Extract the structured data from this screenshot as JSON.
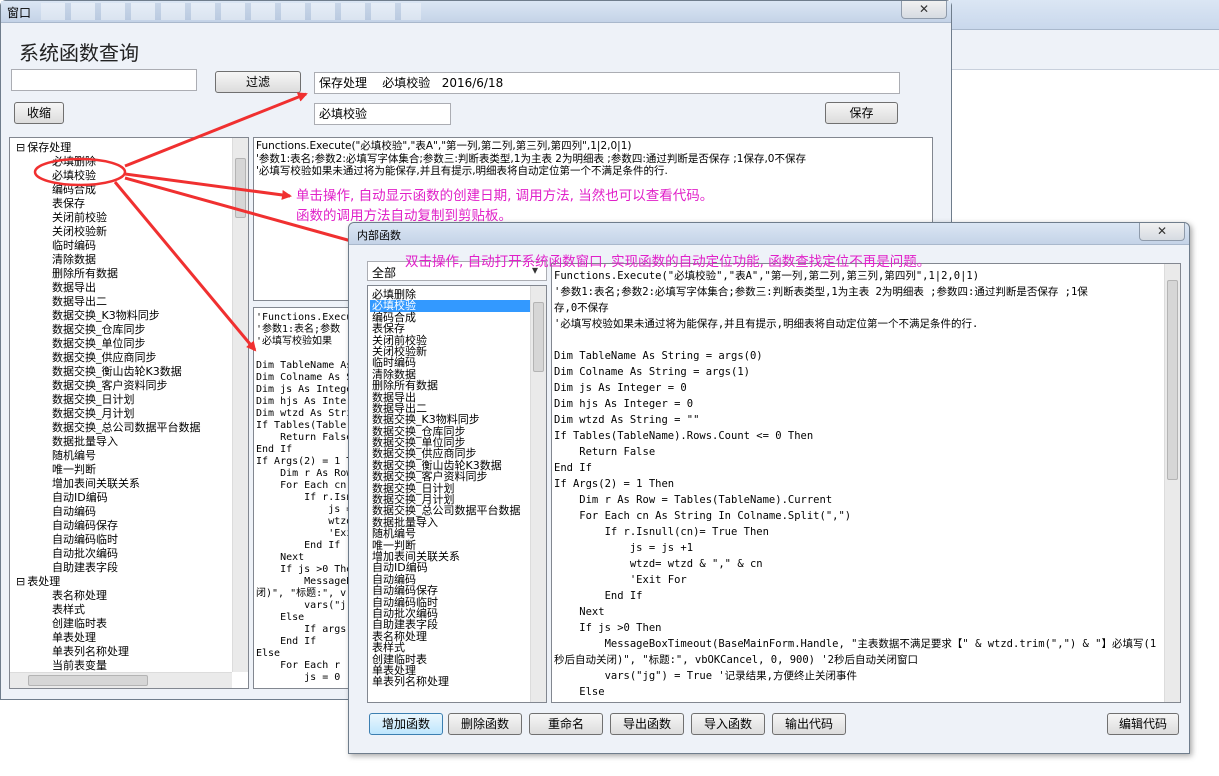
{
  "main_window": {
    "title": "窗口",
    "heading": "系统函数查询",
    "filter_button": "过滤",
    "collapse_button": "收缩",
    "save_button": "保存",
    "filter_input_value": "",
    "info_line": "保存处理    必填校验   2016/6/18",
    "name_value": "必填校验",
    "close_glyph": "✕"
  },
  "tree": {
    "groups": [
      {
        "label": "保存处理",
        "toggle": "⊟",
        "children": [
          "必填删除",
          "必填校验",
          "编码合成",
          "表保存",
          "关闭前校验",
          "关闭校验新",
          "临时编码",
          "清除数据",
          "删除所有数据",
          "数据导出",
          "数据导出二",
          "数据交换_K3物料同步",
          "数据交换_仓库同步",
          "数据交换_单位同步",
          "数据交换_供应商同步",
          "数据交换_衡山齿轮K3数据",
          "数据交换_客户资料同步",
          "数据交换_日计划",
          "数据交换_月计划",
          "数据交换_总公司数据平台数据",
          "数据批量导入",
          "随机编号",
          "唯一判断",
          "增加表间关联关系",
          "自动ID编码",
          "自动编码",
          "自动编码保存",
          "自动编码临时",
          "自动批次编码",
          "自助建表字段"
        ]
      },
      {
        "label": "表处理",
        "toggle": "⊟",
        "children": [
          "表名称处理",
          "表样式",
          "创建临时表",
          "单表处理",
          "单表列名称处理",
          "当前表变量"
        ]
      }
    ]
  },
  "main_code_top": [
    "Functions.Execute(\"必填校验\",\"表A\",\"第一列,第二列,第三列,第四列\",1|2,0|1)",
    "'参数1:表名;参数2:必填写字体集合;参数三:判断表类型,1为主表 2为明细表 ;参数四:通过判断是否保存 ;1保存,0不保存",
    "'必填写校验如果未通过将为能保存,并且有提示,明细表将自动定位第一个不满足条件的行."
  ],
  "main_code_bottom": [
    "'Functions.Execu",
    "'参数1:表名;参数",
    "'必填写校验如果",
    "",
    "Dim TableName As",
    "Dim Colname As S",
    "Dim js As Intege",
    "Dim hjs As Inte",
    "Dim wtzd As Stri",
    "If Tables(Table",
    "    Return False",
    "End If",
    "If Args(2) = 1 T",
    "    Dim r As Row",
    "    For Each cn",
    "        If r.Isnu",
    "            js =",
    "            wtzd",
    "            'Exi",
    "        End If",
    "    Next",
    "    If js >0 The",
    "        MessageB",
    "闭)\", \"标题:\", v",
    "        vars(\"j",
    "    Else",
    "        If args",
    "    End If",
    "Else",
    "    For Each r",
    "        js = 0"
  ],
  "annotations": {
    "single_click_1": "单击操作, 自动显示函数的创建日期, 调用方法, 当然也可以查看代码。",
    "single_click_2": "函数的调用方法自动复制到剪贴板。",
    "double_click": "双击操作, 自动打开系统函数窗口, 实现函数的自动定位功能, 函数查找定位不再是问题。"
  },
  "inner_window": {
    "title": "内部函数",
    "close_glyph": "✕",
    "category_select": "全部",
    "select_arrow": "▾",
    "list_items": [
      "必填删除",
      "必填校验",
      "编码合成",
      "表保存",
      "关闭前校验",
      "关闭校验新",
      "临时编码",
      "清除数据",
      "删除所有数据",
      "数据导出",
      "数据导出二",
      "数据交换_K3物料同步",
      "数据交换_仓库同步",
      "数据交换_单位同步",
      "数据交换_供应商同步",
      "数据交换_衡山齿轮K3数据",
      "数据交换_客户资料同步",
      "数据交换_日计划",
      "数据交换_月计划",
      "数据交换_总公司数据平台数据",
      "数据批量导入",
      "随机编号",
      "唯一判断",
      "增加表间关联关系",
      "自动ID编码",
      "自动编码",
      "自动编码保存",
      "自动编码临时",
      "自动批次编码",
      "自助建表字段",
      "表名称处理",
      "表样式",
      "创建临时表",
      "单表处理",
      "单表列名称处理"
    ],
    "selected_item": "必填校验",
    "code": [
      "Functions.Execute(\"必填校验\",\"表A\",\"第一列,第二列,第三列,第四列\",1|2,0|1)",
      "'参数1:表名;参数2:必填写字体集合;参数三:判断表类型,1为主表 2为明细表 ;参数四:通过判断是否保存 ;1保",
      "存,0不保存",
      "'必填写校验如果未通过将为能保存,并且有提示,明细表将自动定位第一个不满足条件的行.",
      "",
      "Dim TableName As String = args(0)",
      "Dim Colname As String = args(1)",
      "Dim js As Integer = 0",
      "Dim hjs As Integer = 0",
      "Dim wtzd As String = \"\"",
      "If Tables(TableName).Rows.Count <= 0 Then",
      "    Return False",
      "End If",
      "If Args(2) = 1 Then",
      "    Dim r As Row = Tables(TableName).Current",
      "    For Each cn As String In Colname.Split(\",\")",
      "        If r.Isnull(cn)= True Then",
      "            js = js +1",
      "            wtzd= wtzd & \",\" & cn",
      "            'Exit For",
      "        End If",
      "    Next",
      "    If js >0 Then",
      "        MessageBoxTimeout(BaseMainForm.Handle, \"主表数据不满足要求【\" & wtzd.trim(\",\") & \"】必填写(1",
      "秒后自动关闭)\", \"标题:\", vbOKCancel, 0, 900) '2秒后自动关闭窗口",
      "        vars(\"jg\") = True '记录结果,方便终止关闭事件",
      "    Else"
    ],
    "buttons": [
      "增加函数",
      "删除函数",
      "重命名",
      "导出函数",
      "导入函数",
      "输出代码"
    ],
    "edit_button": "编辑代码"
  },
  "colors": {
    "annotation": "#e020c8",
    "arrow": "#f03030",
    "selection": "#3399ff"
  }
}
